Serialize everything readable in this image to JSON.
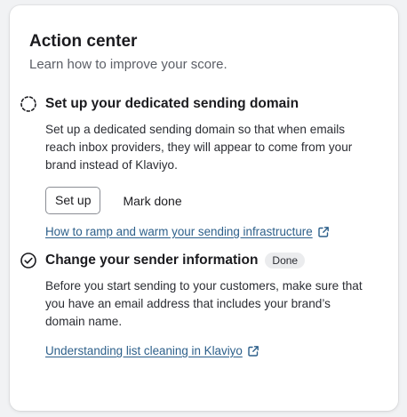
{
  "card": {
    "title": "Action center",
    "subtitle": "Learn how to improve your score."
  },
  "tasks": [
    {
      "status_icon": "dashed-circle-icon",
      "title": "Set up your dedicated sending domain",
      "description": "Set up a dedicated sending domain so that when emails reach inbox providers, they will appear to come from your brand instead of Klaviyo.",
      "primary_action": "Set up",
      "secondary_action": "Mark done",
      "link_text": "How to ramp and warm your sending infrastructure"
    },
    {
      "status_icon": "check-circle-icon",
      "title": "Change your sender information",
      "badge": "Done",
      "description": "Before you start sending to your customers, make sure that you have an email address that includes your brand’s domain name.",
      "link_text": "Understanding list cleaning in Klaviyo"
    }
  ],
  "colors": {
    "link": "#2c5f8a",
    "badge_bg": "#ebecee",
    "text": "#1b1b1f",
    "muted": "#5b5e66"
  }
}
